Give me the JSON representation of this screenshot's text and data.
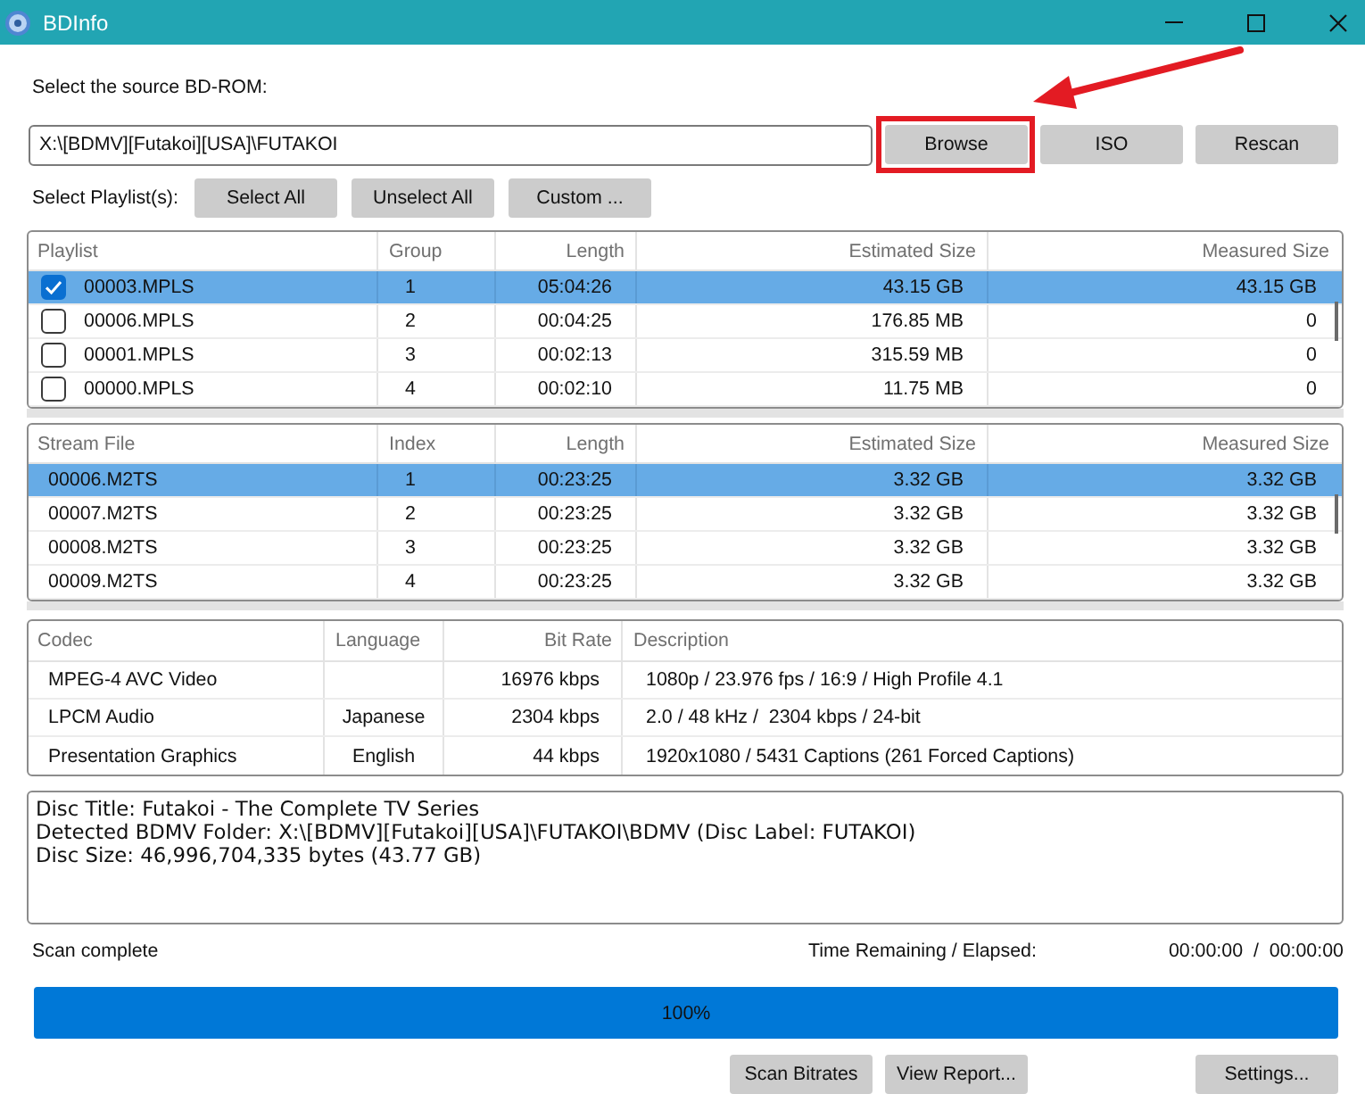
{
  "window": {
    "title": "BDInfo"
  },
  "source": {
    "label": "Select the source BD-ROM:",
    "value": "X:\\[BDMV][Futakoi][USA]\\FUTAKOI",
    "buttons": [
      {
        "label": "Browse",
        "highlighted": true
      },
      {
        "label": "ISO",
        "highlighted": false
      },
      {
        "label": "Rescan",
        "highlighted": false
      }
    ]
  },
  "playlist_selection": {
    "label": "Select Playlist(s):",
    "buttons": [
      "Select All",
      "Unselect All",
      "Custom ..."
    ]
  },
  "playlists": {
    "columns": [
      "Playlist",
      "Group",
      "Length",
      "Estimated Size",
      "Measured Size"
    ],
    "rows": [
      {
        "playlist": "00003.MPLS",
        "group": "1",
        "length": "05:04:26",
        "estimated_size": "43.15 GB",
        "measured_size": "43.15 GB",
        "checked": true,
        "selected": true
      },
      {
        "playlist": "00006.MPLS",
        "group": "2",
        "length": "00:04:25",
        "estimated_size": "176.85 MB",
        "measured_size": "0",
        "checked": false,
        "selected": false
      },
      {
        "playlist": "00001.MPLS",
        "group": "3",
        "length": "00:02:13",
        "estimated_size": "315.59 MB",
        "measured_size": "0",
        "checked": false,
        "selected": false
      },
      {
        "playlist": "00000.MPLS",
        "group": "4",
        "length": "00:02:10",
        "estimated_size": "11.75 MB",
        "measured_size": "0",
        "checked": false,
        "selected": false
      }
    ]
  },
  "streams": {
    "columns": [
      "Stream File",
      "Index",
      "Length",
      "Estimated Size",
      "Measured Size"
    ],
    "rows": [
      {
        "stream_file": "00006.M2TS",
        "index": "1",
        "length": "00:23:25",
        "estimated_size": "3.32 GB",
        "measured_size": "3.32 GB",
        "selected": true
      },
      {
        "stream_file": "00007.M2TS",
        "index": "2",
        "length": "00:23:25",
        "estimated_size": "3.32 GB",
        "measured_size": "3.32 GB",
        "selected": false
      },
      {
        "stream_file": "00008.M2TS",
        "index": "3",
        "length": "00:23:25",
        "estimated_size": "3.32 GB",
        "measured_size": "3.32 GB",
        "selected": false
      },
      {
        "stream_file": "00009.M2TS",
        "index": "4",
        "length": "00:23:25",
        "estimated_size": "3.32 GB",
        "measured_size": "3.32 GB",
        "selected": false
      }
    ]
  },
  "codecs": {
    "columns": [
      "Codec",
      "Language",
      "Bit Rate",
      "Description"
    ],
    "rows": [
      {
        "codec": "MPEG-4 AVC Video",
        "bit_rate": "16976 kbps",
        "description": "1080p / 23.976 fps / 16:9 / High Profile 4.1"
      },
      {
        "codec": "LPCM Audio",
        "language": "Japanese",
        "bit_rate": "2304 kbps",
        "description": "2.0 / 48 kHz /  2304 kbps / 24-bit"
      },
      {
        "codec": "Presentation Graphics",
        "language": "English",
        "bit_rate": "44 kbps",
        "description": "1920x1080 / 5431 Captions (261 Forced Captions)"
      }
    ]
  },
  "disc_info": [
    "Disc Title: Futakoi - The Complete TV Series",
    "Detected BDMV Folder: X:\\[BDMV][Futakoi][USA]\\FUTAKOI\\BDMV (Disc Label: FUTAKOI)",
    "Disc Size: 46,996,704,335 bytes (43.77 GB)"
  ],
  "status": {
    "text": "Scan complete",
    "time_label": "Time Remaining / Elapsed:",
    "time": "00:00:00  /  00:00:00"
  },
  "progress": {
    "level": 1,
    "label": "100%"
  },
  "actions": [
    "Scan Bitrates",
    "View Report..."
  ],
  "settings_button": "Settings..."
}
